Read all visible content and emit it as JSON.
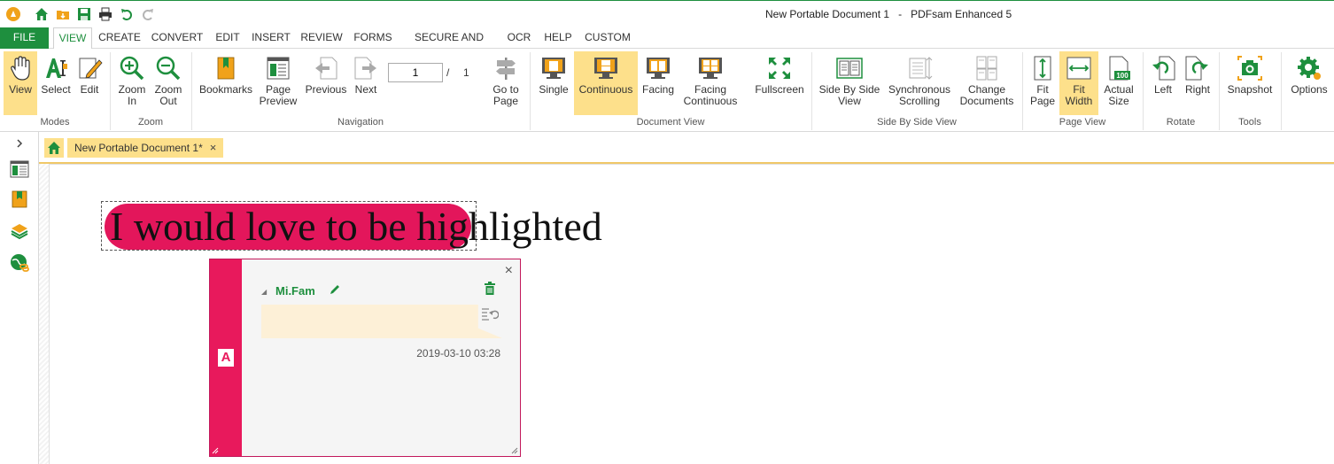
{
  "window": {
    "title": "New Portable Document 1   -   PDFsam Enhanced 5"
  },
  "quick_access": [
    "app-logo-icon",
    "home-icon",
    "open-folder-icon",
    "save-icon",
    "print-icon",
    "undo-icon",
    "redo-icon"
  ],
  "menu_tabs": [
    {
      "label": "FILE"
    },
    {
      "label": "VIEW"
    },
    {
      "label": "CREATE"
    },
    {
      "label": "CONVERT"
    },
    {
      "label": "EDIT"
    },
    {
      "label": "INSERT"
    },
    {
      "label": "REVIEW"
    },
    {
      "label": "FORMS"
    },
    {
      "label": "SECURE AND SIGN"
    },
    {
      "label": "OCR"
    },
    {
      "label": "HELP"
    },
    {
      "label": "CUSTOM"
    }
  ],
  "ribbon": {
    "groups": {
      "modes": "Modes",
      "zoom": "Zoom",
      "navigation": "Navigation",
      "document_view": "Document View",
      "side_by_side": "Side By Side View",
      "page_view": "Page View",
      "rotate": "Rotate",
      "tools": "Tools"
    },
    "buttons": {
      "view": "View",
      "select": "Select",
      "edit": "Edit",
      "zoom_in": "Zoom\nIn",
      "zoom_out": "Zoom\nOut",
      "bookmarks": "Bookmarks",
      "page_preview": "Page\nPreview",
      "previous": "Previous",
      "next": "Next",
      "go_to_page": "Go to\nPage",
      "single": "Single",
      "continuous": "Continuous",
      "facing": "Facing",
      "facing_continuous": "Facing\nContinuous",
      "fullscreen": "Fullscreen",
      "side_by_side_view": "Side By Side\nView",
      "sync_scrolling": "Synchronous\nScrolling",
      "change_documents": "Change\nDocuments",
      "fit_page": "Fit\nPage",
      "fit_width": "Fit\nWidth",
      "actual_size": "Actual\nSize",
      "left": "Left",
      "right": "Right",
      "snapshot": "Snapshot",
      "options": "Options"
    },
    "page_number": "1",
    "page_slash": "/",
    "page_total": "1",
    "actual_size_badge": "100"
  },
  "document_tab": {
    "label": "New Portable Document 1*",
    "close": "×"
  },
  "document": {
    "text": "I would love to be highlighted"
  },
  "comment": {
    "marker": "A",
    "close": "×",
    "author": "Mi.Fam",
    "collapse": "◢",
    "date": "2019-03-10 03:28"
  },
  "colors": {
    "accent_green": "#1e8f3e",
    "active_yellow": "#fde08b",
    "highlight_pink": "#e3165b"
  }
}
